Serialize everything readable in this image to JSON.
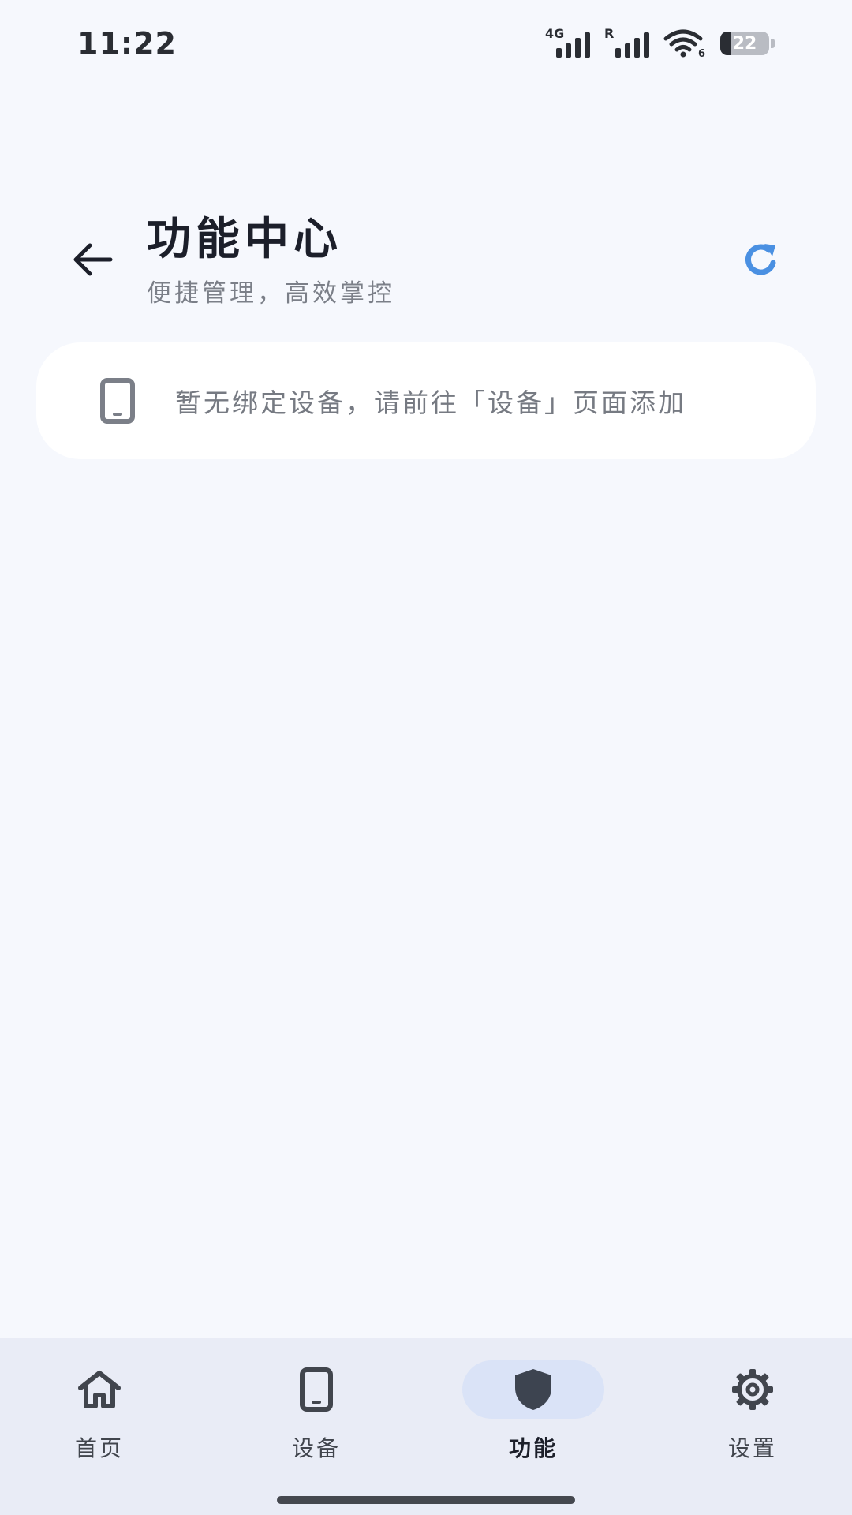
{
  "status_bar": {
    "time": "11:22",
    "signal1_tag": "4G",
    "signal2_tag": "R",
    "wifi_tag": "6",
    "battery_level": "22"
  },
  "header": {
    "title": "功能中心",
    "subtitle": "便捷管理，高效掌控",
    "back_icon": "arrow-left-icon",
    "refresh_icon": "refresh-icon"
  },
  "empty_state": {
    "icon": "phone-icon",
    "message": "暂无绑定设备，请前往「设备」页面添加"
  },
  "bottom_nav": {
    "items": [
      {
        "label": "首页",
        "icon": "home-icon",
        "active": false
      },
      {
        "label": "设备",
        "icon": "phone-icon",
        "active": false
      },
      {
        "label": "功能",
        "icon": "shield-icon",
        "active": true
      },
      {
        "label": "设置",
        "icon": "gear-icon",
        "active": false
      }
    ]
  },
  "colors": {
    "background": "#f6f8fd",
    "accent": "#4a90e2",
    "nav_background": "#e9ecf6",
    "nav_active_pill": "#dae3f7"
  }
}
